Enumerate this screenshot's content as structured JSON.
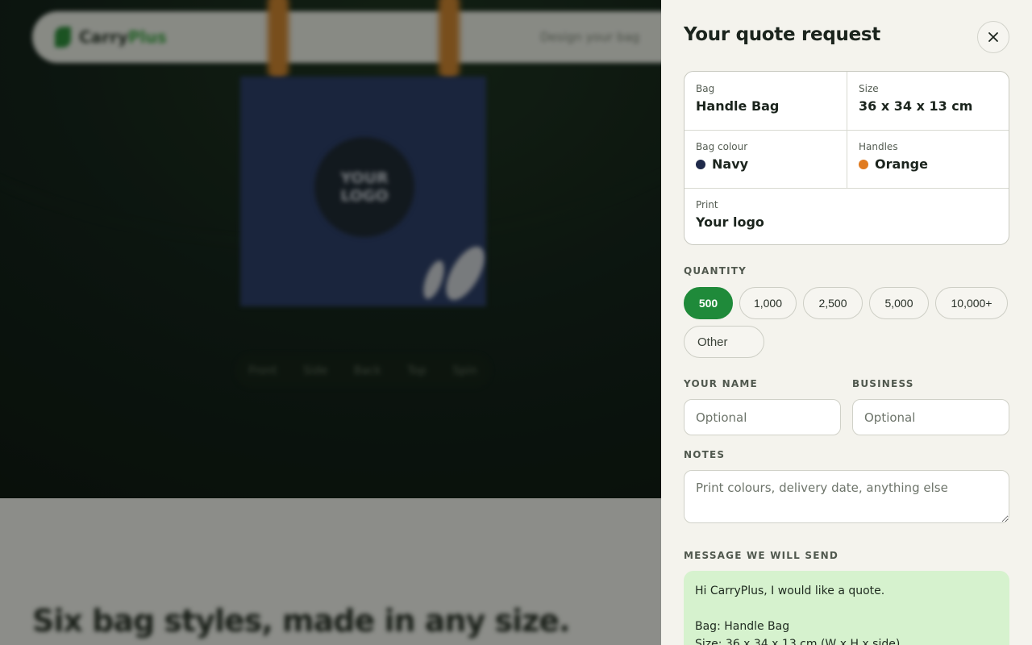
{
  "background": {
    "brand_prefix": "Carry",
    "brand_suffix": "Plus",
    "nav_link": "Design your bag",
    "bag_logo_line1": "YOUR",
    "bag_logo_line2": "LOGO",
    "view_tabs": [
      "Front",
      "Side",
      "Back",
      "Top",
      "Spin"
    ],
    "headline": "Six bag styles, made in any size."
  },
  "drawer": {
    "title": "Your quote request",
    "close_icon": "close-icon",
    "summary": {
      "bag": {
        "label": "Bag",
        "value": "Handle Bag"
      },
      "size": {
        "label": "Size",
        "value": "36 x 34 x 13 cm"
      },
      "bag_colour": {
        "label": "Bag colour",
        "value": "Navy",
        "swatch": "#1f2a4a"
      },
      "handles": {
        "label": "Handles",
        "value": "Orange",
        "swatch": "#e07a1f"
      },
      "print": {
        "label": "Print",
        "value": "Your logo"
      }
    },
    "quantity": {
      "label": "QUANTITY",
      "options": [
        "500",
        "1,000",
        "2,500",
        "5,000",
        "10,000+"
      ],
      "selected": "500",
      "other_label": "Other"
    },
    "name": {
      "label": "YOUR NAME",
      "placeholder": "Optional"
    },
    "business": {
      "label": "BUSINESS",
      "placeholder": "Optional"
    },
    "notes": {
      "label": "NOTES",
      "placeholder": "Print colours, delivery date, anything else"
    },
    "message": {
      "label": "MESSAGE WE WILL SEND",
      "line1": "Hi CarryPlus, I would like a quote.",
      "line2": "Bag: Handle Bag",
      "line3": "Size: 36 x 34 x 13 cm (W x H x side)"
    },
    "accent_color": "#1f8a3a",
    "message_bg": "#d6f2ce"
  }
}
